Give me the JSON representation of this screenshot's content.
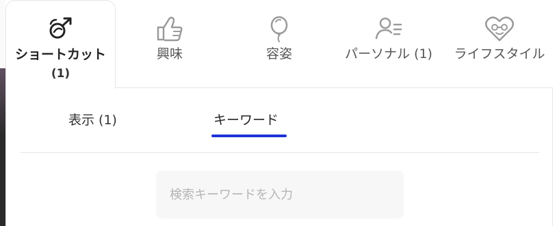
{
  "category_tabs": [
    {
      "label": "ショートカット",
      "count": "(1)",
      "icon": "shortcut-icon",
      "active": true
    },
    {
      "label": "興味",
      "icon": "thumbs-up-icon",
      "active": false
    },
    {
      "label": "容姿",
      "icon": "balloon-icon",
      "active": false
    },
    {
      "label": "パーソナル (1)",
      "icon": "person-list-icon",
      "active": false
    },
    {
      "label": "ライフスタイル",
      "icon": "heart-face-icon",
      "active": false
    }
  ],
  "sub_tabs": {
    "display": {
      "label": "表示 (1)",
      "active": false
    },
    "keyword": {
      "label": "キーワード",
      "active": true
    }
  },
  "search": {
    "placeholder": "検索キーワードを入力",
    "value": ""
  },
  "colors": {
    "accent_underline": "#1b33d6",
    "icon_stroke": "#9a9a9a",
    "active_icon_stroke": "#222222"
  }
}
